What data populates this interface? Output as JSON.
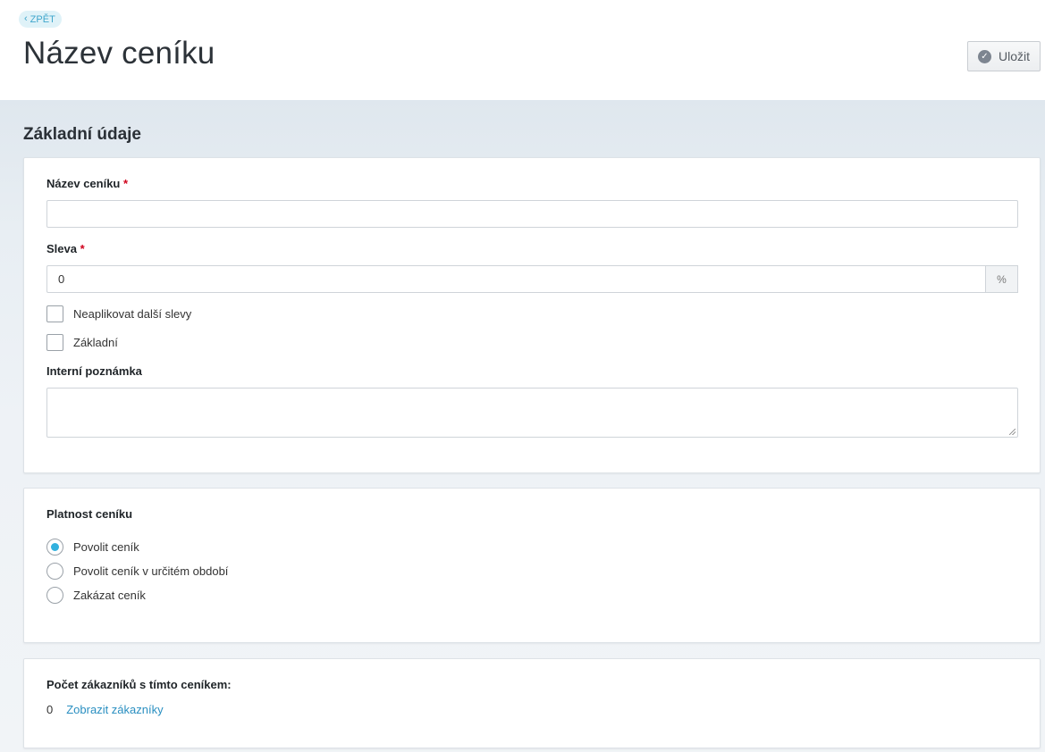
{
  "header": {
    "back_label": "ZPĚT",
    "title": "Název ceníku",
    "save_label": "Uložit"
  },
  "section": {
    "title": "Základní údaje"
  },
  "basic": {
    "name_label": "Název ceníku",
    "name_value": "",
    "discount_label": "Sleva",
    "discount_value": "0",
    "discount_unit": "%",
    "required_mark": "*",
    "checkboxes": [
      {
        "label": "Neaplikovat další slevy",
        "checked": false
      },
      {
        "label": "Základní",
        "checked": false
      }
    ],
    "note_label": "Interní poznámka",
    "note_value": ""
  },
  "validity": {
    "title": "Platnost ceníku",
    "options": [
      {
        "label": "Povolit ceník",
        "selected": true
      },
      {
        "label": "Povolit ceník v určitém období",
        "selected": false
      },
      {
        "label": "Zakázat ceník",
        "selected": false
      }
    ]
  },
  "customers": {
    "title": "Počet zákazníků s tímto ceníkem:",
    "count": "0",
    "link_label": "Zobrazit zákazníky"
  },
  "colors": {
    "accent": "#32b1de",
    "link": "#2a8fc1",
    "required": "#d0011b"
  }
}
